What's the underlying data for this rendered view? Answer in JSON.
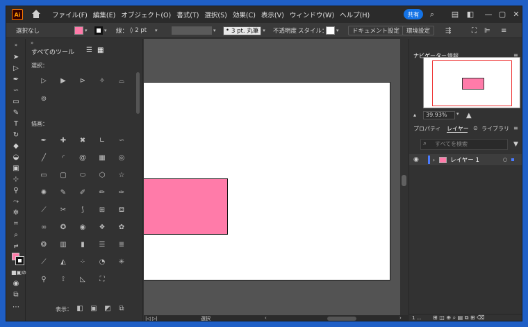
{
  "menubar": {
    "logo": "Ai",
    "menus": [
      "ファイル(F)",
      "編集(E)",
      "オブジェクト(O)",
      "書式(T)",
      "選択(S)",
      "効果(C)",
      "表示(V)",
      "ウィンドウ(W)",
      "ヘルプ(H)"
    ],
    "share_label": "共有",
    "window_controls": [
      "—",
      "▢",
      "✕"
    ]
  },
  "controlbar": {
    "selection_label": "選択なし",
    "fill_color": "#ff7ba9",
    "stroke_label": "線：",
    "stroke_value": "2 pt",
    "brush_label": "3 pt. 丸筆",
    "opacity_label": "不透明度",
    "style_label": "スタイル：",
    "doc_settings_label": "ドキュメント設定",
    "prefs_label": "環境設定"
  },
  "all_tools_panel": {
    "title": "すべてのツール",
    "section_select": "選択：",
    "section_draw": "描画：",
    "display_label": "表示："
  },
  "navigator": {
    "tab_navigator": "ナビゲーター",
    "tab_info": "情報",
    "zoom": "39.93%"
  },
  "layers_panel": {
    "tab_properties": "プロパティ",
    "tab_layers": "レイヤー",
    "tab_libraries": "ライブラリ",
    "search_placeholder": "すべてを検索",
    "layer_name": "レイヤー 1",
    "layer_count": "1 ..."
  },
  "statusbar": {
    "tool_label": "選択"
  },
  "colors": {
    "accent": "#1473e6",
    "shape_fill": "#ff7ba9"
  }
}
